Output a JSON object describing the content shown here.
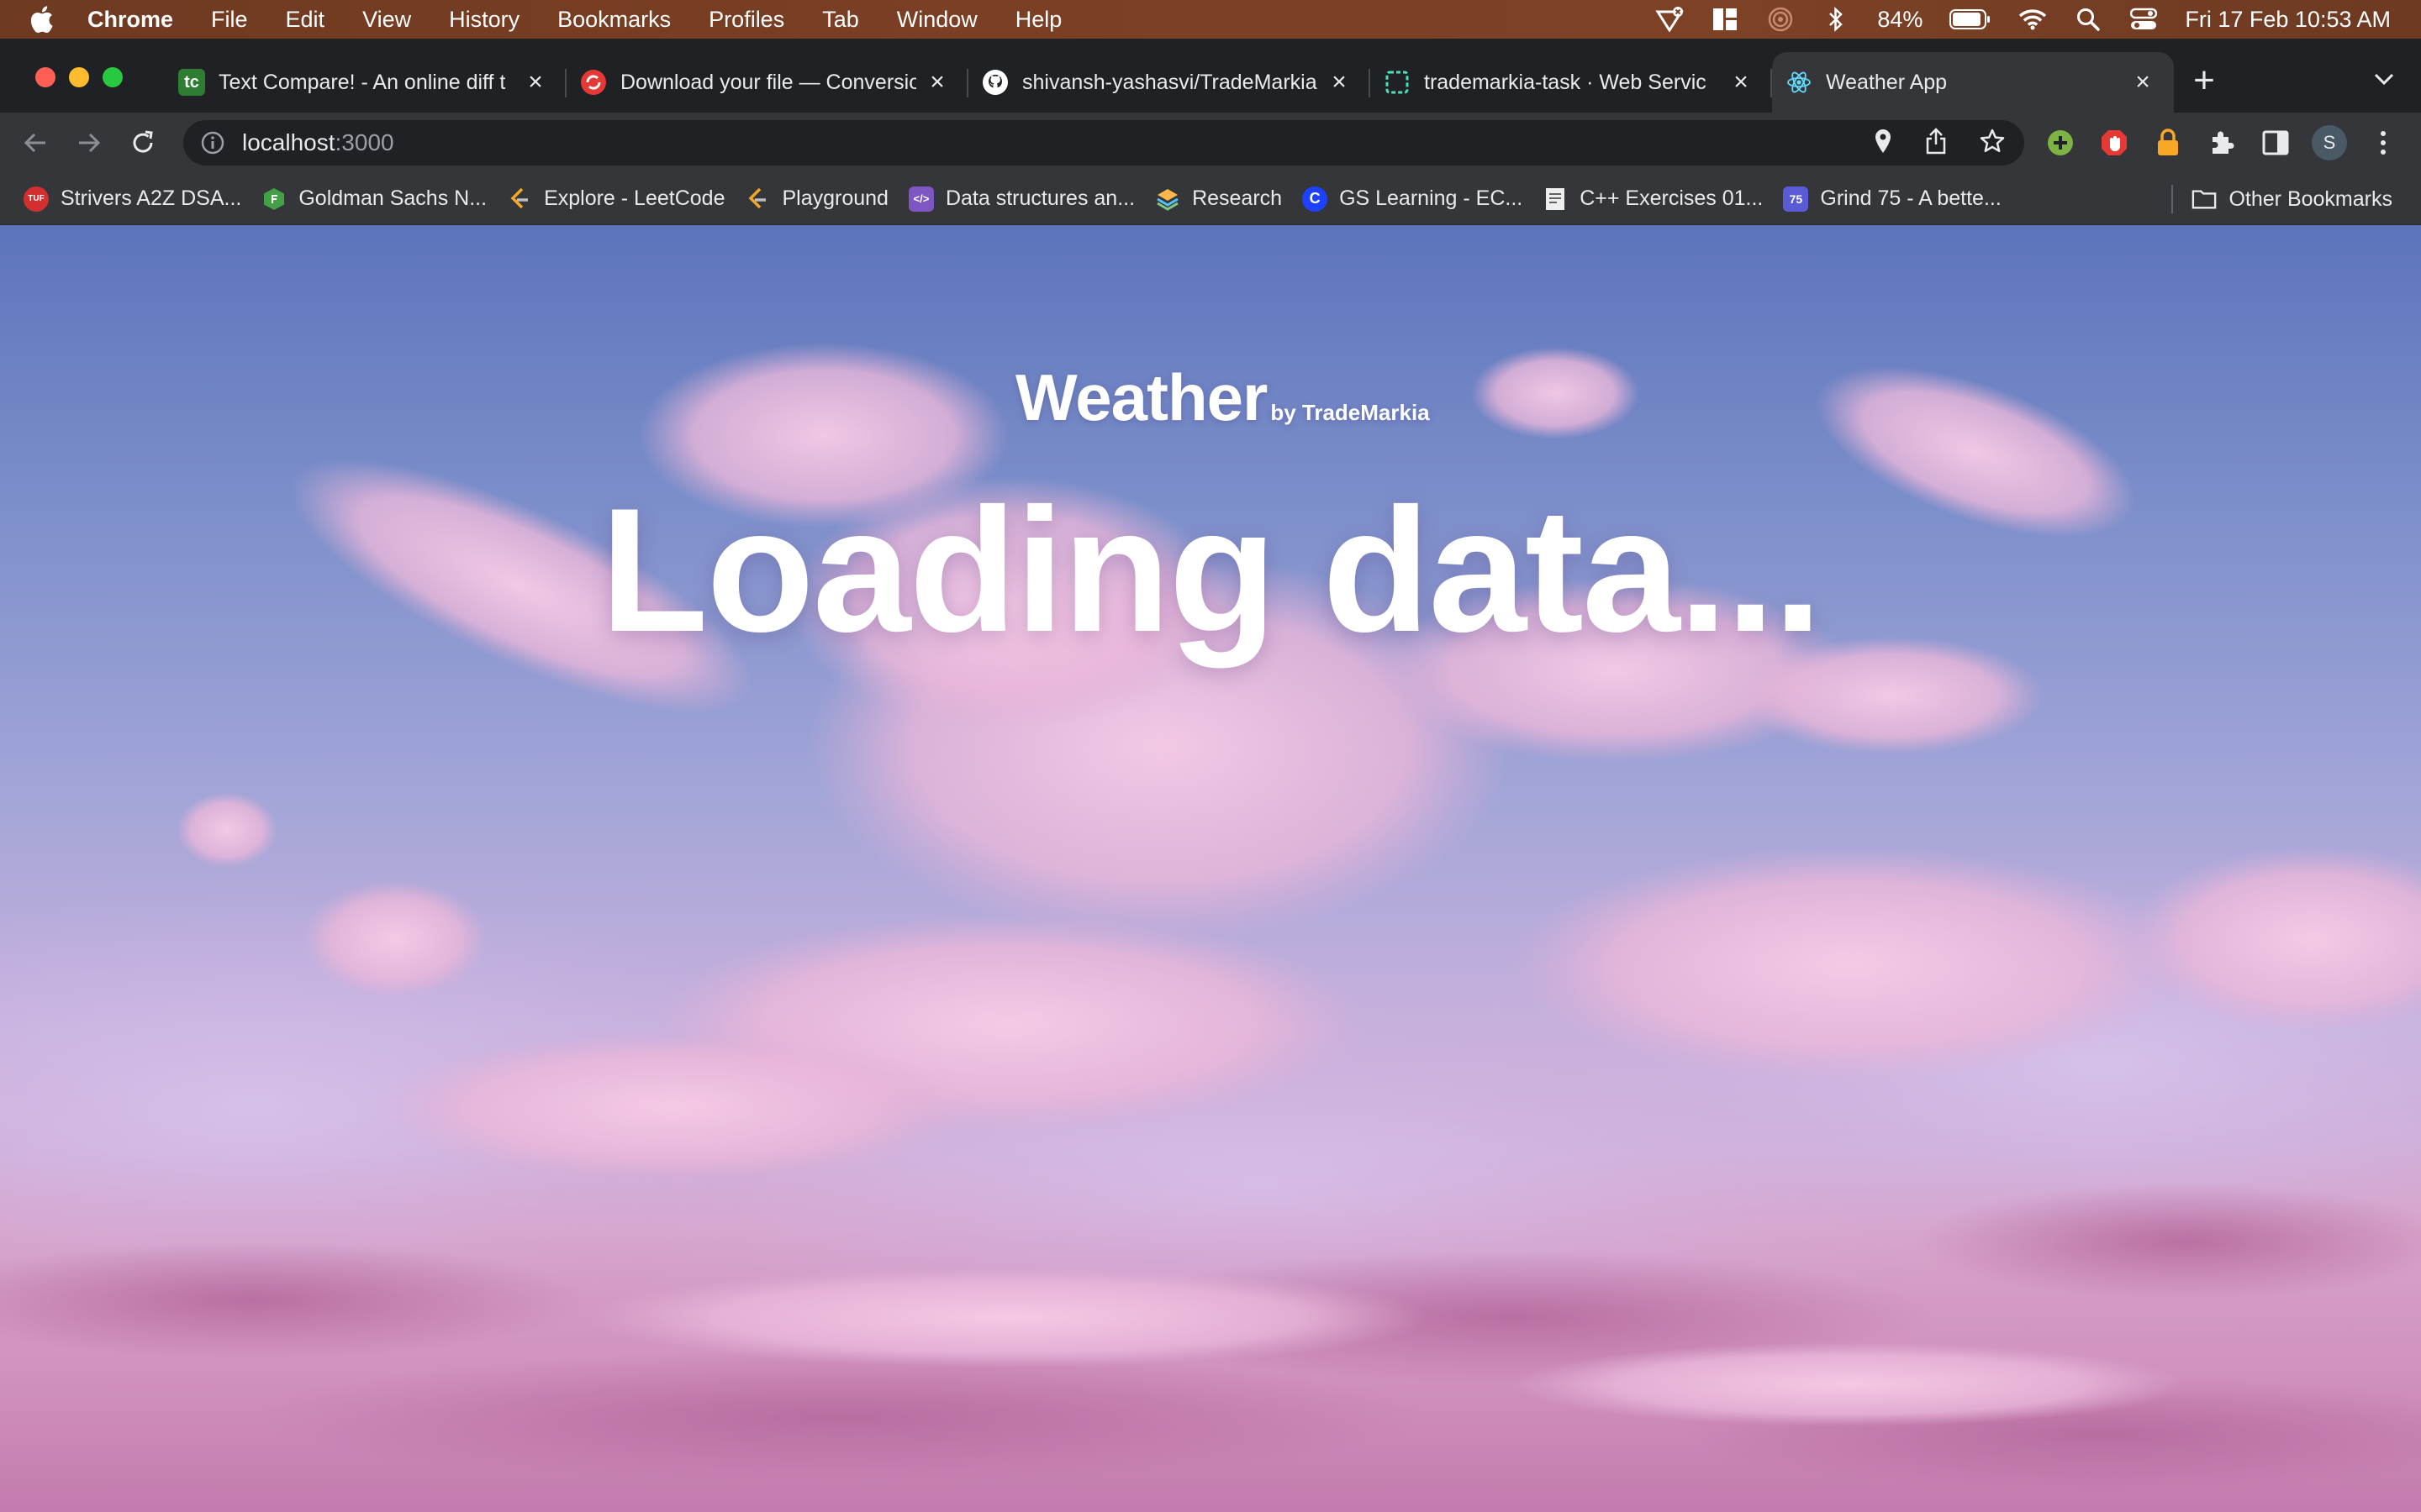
{
  "menubar": {
    "app_name": "Chrome",
    "items": [
      "File",
      "Edit",
      "View",
      "History",
      "Bookmarks",
      "Profiles",
      "Tab",
      "Window",
      "Help"
    ],
    "battery_percent": "84%",
    "datetime": "Fri 17 Feb  10:53 AM"
  },
  "tabs": [
    {
      "title": "Text Compare! - An online diff t",
      "favicon": "text-compare",
      "favicon_color": "#2e7d32",
      "favicon_text": "tc"
    },
    {
      "title": "Download your file — Conversio",
      "favicon": "convertio",
      "favicon_color": "#e53935",
      "favicon_text": ""
    },
    {
      "title": "shivansh-yashasvi/TradeMarkia",
      "favicon": "github",
      "favicon_color": "#ffffff",
      "favicon_text": ""
    },
    {
      "title": "trademarkia-task · Web Servic",
      "favicon": "render",
      "favicon_color": "#46e3b7",
      "favicon_text": ""
    },
    {
      "title": "Weather App",
      "favicon": "react",
      "favicon_color": "#61dafb",
      "favicon_text": "",
      "active": true
    }
  ],
  "address_bar": {
    "host": "localhost",
    "port": ":3000"
  },
  "profile_initial": "S",
  "bookmarks": [
    {
      "label": "Strivers A2Z DSA...",
      "icon_color": "#d32f2f",
      "icon_text": "TUF"
    },
    {
      "label": "Goldman Sachs N...",
      "icon_color": "#43a047",
      "icon_text": ""
    },
    {
      "label": "Explore - LeetCode",
      "icon_color": "#f57c00",
      "icon_text": ""
    },
    {
      "label": "Playground",
      "icon_color": "#f57c00",
      "icon_text": ""
    },
    {
      "label": "Data structures an...",
      "icon_color": "#7e57c2",
      "icon_text": "</>"
    },
    {
      "label": "Research",
      "icon_color": "#ef6c00",
      "icon_text": ""
    },
    {
      "label": "GS Learning - EC...",
      "icon_color": "#1e40ff",
      "icon_text": "C"
    },
    {
      "label": "C++ Exercises 01...",
      "icon_color": "#eeeeee",
      "icon_text": ""
    },
    {
      "label": "Grind 75 - A bette...",
      "icon_color": "#5b5bd6",
      "icon_text": "75"
    }
  ],
  "other_bookmarks": "Other Bookmarks",
  "page": {
    "brand_name": "Weather",
    "brand_sub": "by TradeMarkia",
    "status": "Loading data..."
  },
  "colors": {
    "menubar": "#7b3f24",
    "tab_strip": "#202124",
    "toolbar": "#35363a",
    "sky_top": "#5c74bb",
    "sky_bottom": "#c88ab8",
    "cloud_pink": "#f2bfe0"
  }
}
